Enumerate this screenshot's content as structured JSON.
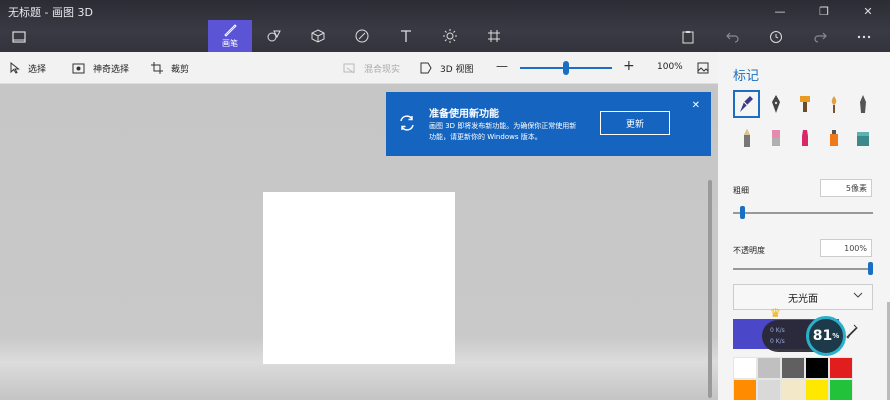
{
  "window": {
    "title": "无标题 - 画图 3D",
    "controls": [
      "—",
      "❐",
      "✕"
    ]
  },
  "ribbon": {
    "active_tool_label": "画笔",
    "tools": [
      "brush",
      "shapes-2d",
      "shapes-3d",
      "stickers",
      "text",
      "effects",
      "canvas"
    ],
    "right": [
      "paste",
      "undo",
      "history",
      "redo",
      "more"
    ]
  },
  "toolbar": {
    "select": "选择",
    "magic_select": "神奇选择",
    "crop": "裁剪",
    "mixed_reality": "混合现实",
    "view_3d": "3D 视图",
    "zoom_percent": "100%",
    "zoom_minus": "—",
    "zoom_plus": "+",
    "zoom_level": 0.5
  },
  "notification": {
    "title": "准备使用新功能",
    "body": "画图 3D 即将发布新功能。为确保你正常使用新功能，请更新你的 Windows 版本。",
    "button": "更新",
    "close": "✕"
  },
  "panel": {
    "title": "标记",
    "thickness_label": "粗细",
    "thickness_value": "5像素",
    "thickness_level": 0.05,
    "opacity_label": "不透明度",
    "opacity_value": "100%",
    "opacity_level": 1.0,
    "finish": "无光面",
    "current_color": "#4b47c9",
    "swatches": [
      "#ffffff",
      "#c0c0c0",
      "#606060",
      "#000000",
      "#e11d1d",
      "#ff8c00",
      "#d9d9d9",
      "#f3e8c8",
      "#ffe800",
      "#22c33a"
    ]
  },
  "speed_widget": {
    "up": "0 K/s",
    "down": "0 K/s",
    "percent": "81",
    "percent_sign": "%"
  }
}
